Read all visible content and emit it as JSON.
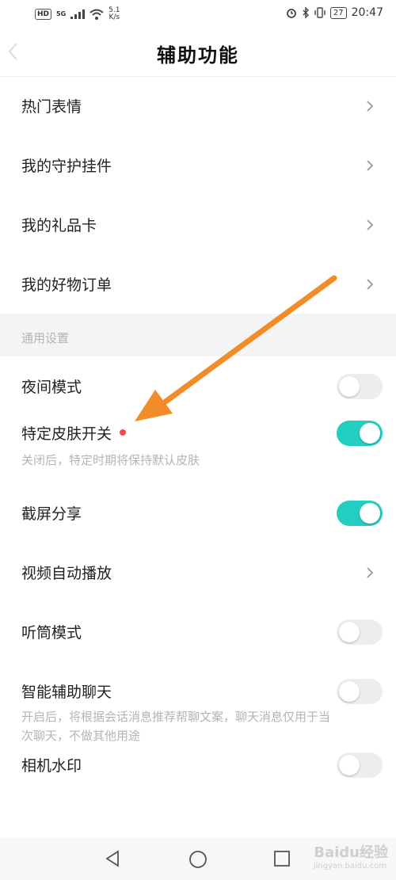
{
  "status_bar": {
    "hd": "HD",
    "network": "5G",
    "speed_value": "5.1",
    "speed_unit": "K/s",
    "battery": "27",
    "time": "20:47"
  },
  "header": {
    "title": "辅助功能"
  },
  "nav_rows": [
    {
      "label": "热门表情"
    },
    {
      "label": "我的守护挂件"
    },
    {
      "label": "我的礼品卡"
    },
    {
      "label": "我的好物订单"
    }
  ],
  "general_section": {
    "title": "通用设置",
    "night_mode": {
      "label": "夜间模式",
      "on": false
    },
    "skin_switch": {
      "label": "特定皮肤开关",
      "on": true,
      "desc": "关闭后，特定时期将保持默认皮肤"
    },
    "screenshot_share": {
      "label": "截屏分享",
      "on": true
    },
    "video_autoplay": {
      "label": "视频自动播放"
    },
    "earpiece_mode": {
      "label": "听筒模式",
      "on": false
    },
    "smart_chat": {
      "label": "智能辅助聊天",
      "on": false,
      "desc_line1": "开启后，将根据会话消息推荐帮聊文案，聊天消息仅用于当",
      "desc_line2": "次聊天，不做其他用途"
    },
    "camera_watermark": {
      "label": "相机水印",
      "on": false
    }
  },
  "watermark": {
    "brand": "Baidu经验",
    "url": "jingyan.baidu.com"
  },
  "colors": {
    "accent": "#22cec0",
    "annotation_arrow": "#f28c28",
    "red_dot": "#f24b4b"
  }
}
